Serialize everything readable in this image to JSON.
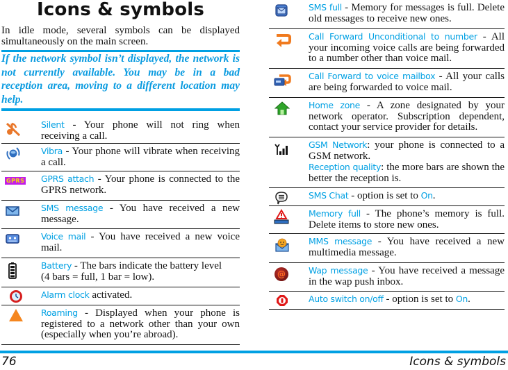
{
  "header": {
    "title": "Icons & symbols"
  },
  "intro": "In idle mode, several symbols can be displayed simultaneously on the main screen.",
  "note": "If the network symbol isn’t displayed, the network is not currently available. You may be in a bad reception area, moving to a different location may help.",
  "left_items": [
    {
      "icon": "silent-icon",
      "name": "Silent",
      "desc": " - Your phone will not ring when receiving a call."
    },
    {
      "icon": "vibra-icon",
      "name": "Vibra",
      "desc": " - Your phone will vibrate when receiving a call."
    },
    {
      "icon": "gprs-icon",
      "icon_text": "GPRS",
      "name": "GPRS attach",
      "desc": " - Your phone is connected to the GPRS network."
    },
    {
      "icon": "sms-envelope-icon",
      "name": "SMS message",
      "desc": " - You have received a new message."
    },
    {
      "icon": "voice-mail-icon",
      "name": "Voice mail",
      "desc": " - You have received a new voice mail."
    },
    {
      "icon": "battery-icon",
      "name": "Battery",
      "desc": " - The bars indicate the battery level",
      "desc2": "(4 bars = full, 1 bar = low)."
    },
    {
      "icon": "alarm-clock-icon",
      "name": "Alarm clock",
      "desc": " activated."
    },
    {
      "icon": "roaming-icon",
      "name": "Roaming",
      "desc": " - Displayed when your phone is registered to a network other than your own (especially when you’re abroad)."
    }
  ],
  "right_items": [
    {
      "icon": "sms-full-icon",
      "name": "SMS full",
      "desc": " - Memory for messages is full. Delete old messages to receive new ones."
    },
    {
      "icon": "call-forward-number-icon",
      "name": "Call Forward Unconditional to number",
      "desc": " - All your incoming voice calls are being forwarded to a number other than voice mail."
    },
    {
      "icon": "call-forward-voicemail-icon",
      "name": "Call Forward to voice mailbox",
      "desc": " - All your calls are being forwarded to voice mail."
    },
    {
      "icon": "home-zone-icon",
      "name": "Home zone",
      "desc": " - A zone designated by your network operator. Subscription dependent, contact your service provider for details."
    },
    {
      "icon": "signal-icon",
      "name": "GSM Network",
      "desc": ": your phone is connected to a GSM network.",
      "name2": "Reception quality",
      "desc2": ": the more bars are shown the better the reception is."
    },
    {
      "icon": "sms-chat-icon",
      "name": "SMS Chat",
      "desc": " - option is set to ",
      "name2": "On",
      "desc2": "."
    },
    {
      "icon": "memory-full-icon",
      "name": "Memory full",
      "desc": " - The phone’s memory is full. Delete items to store new ones."
    },
    {
      "icon": "mms-icon",
      "name": "MMS message",
      "desc": " - You have received a new multimedia message."
    },
    {
      "icon": "wap-message-icon",
      "icon_text": "@",
      "name": "Wap message",
      "desc": " - You have received a message in the wap push inbox."
    },
    {
      "icon": "auto-switch-icon",
      "name": "Auto switch on/off",
      "desc": " - option is set to ",
      "name2": "On",
      "desc2": "."
    }
  ],
  "footer": {
    "page_number": "76",
    "running_title": "Icons & symbols"
  },
  "colors": {
    "accent": "#00a0e3",
    "rule": "#111111"
  }
}
